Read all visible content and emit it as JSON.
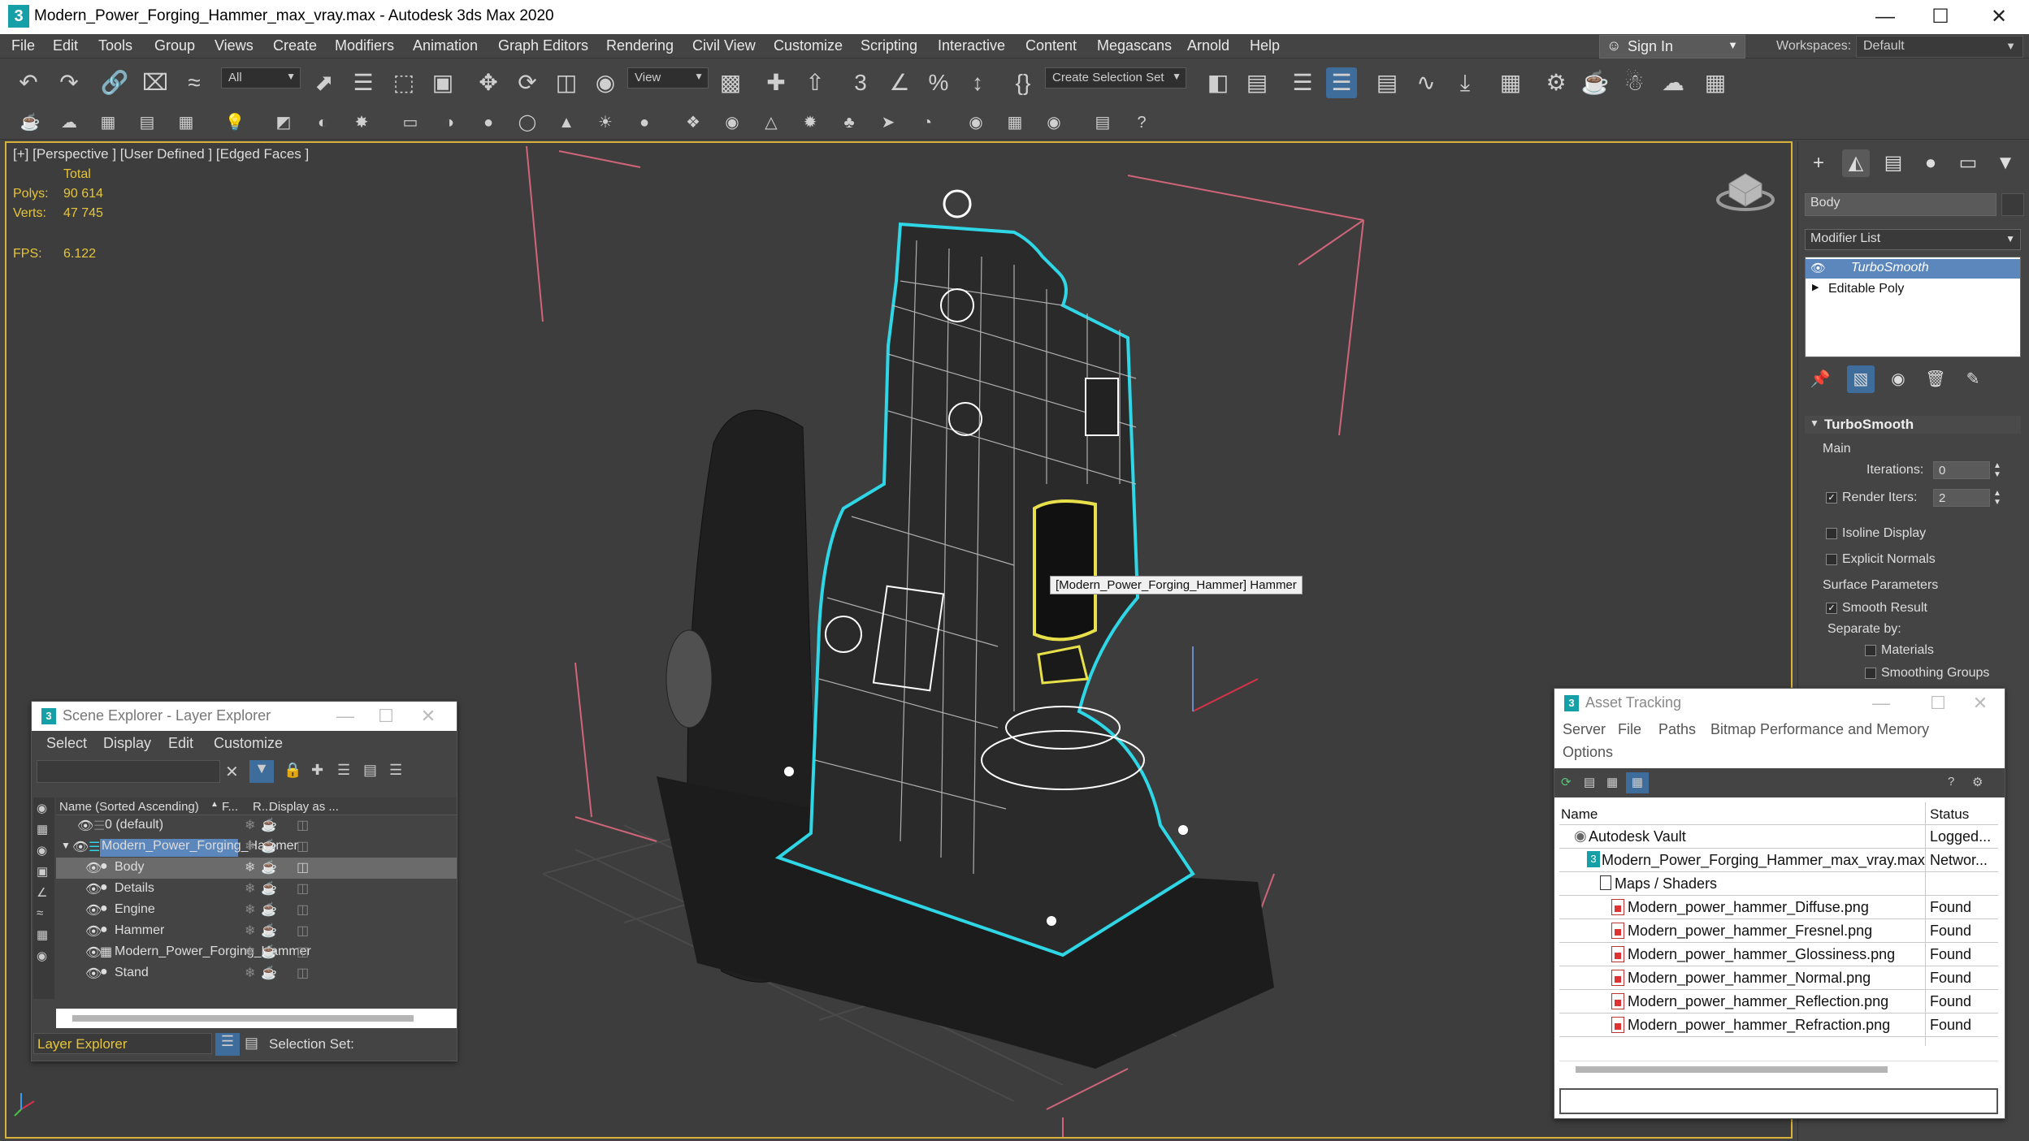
{
  "window": {
    "title": "Modern_Power_Forging_Hammer_max_vray.max - Autodesk 3ds Max 2020",
    "icon": "3"
  },
  "menu": [
    "File",
    "Edit",
    "Tools",
    "Group",
    "Views",
    "Create",
    "Modifiers",
    "Animation",
    "Graph Editors",
    "Rendering",
    "Civil View",
    "Customize",
    "Scripting",
    "Interactive",
    "Content",
    "Megascans",
    "Arnold",
    "Help"
  ],
  "signin": "Sign In",
  "workspaces": {
    "label": "Workspaces:",
    "value": "Default"
  },
  "toolbar": {
    "filter": "All",
    "refcoord": "View",
    "selection_set": "Create Selection Set"
  },
  "viewport": {
    "label": "[+] [Perspective ] [User Defined ] [Edged Faces ]",
    "stats": {
      "total": "Total",
      "polys_label": "Polys:",
      "polys": "90 614",
      "verts_label": "Verts:",
      "verts": "47 745",
      "fps_label": "FPS:",
      "fps": "6.122"
    },
    "tooltip": "[Modern_Power_Forging_Hammer] Hammer"
  },
  "command_panel": {
    "object_name": "Body",
    "modifier_list": "Modifier List",
    "stack": [
      "TurboSmooth",
      "Editable Poly"
    ],
    "rollout": "TurboSmooth",
    "main": "Main",
    "iterations_label": "Iterations:",
    "iterations": "0",
    "render_iters_label": "Render Iters:",
    "render_iters": "2",
    "isoline": "Isoline Display",
    "explicit": "Explicit Normals",
    "surface": "Surface Parameters",
    "smooth_result": "Smooth Result",
    "separate_by": "Separate by:",
    "materials": "Materials",
    "smoothing_groups": "Smoothing Groups"
  },
  "scene_explorer": {
    "title": "Scene Explorer - Layer Explorer",
    "menu": [
      "Select",
      "Display",
      "Edit",
      "Customize"
    ],
    "columns": {
      "name": "Name (Sorted Ascending)",
      "f": "F...",
      "r": "R...",
      "display": "Display as ..."
    },
    "rows": [
      {
        "label": "0 (default)",
        "level": 0
      },
      {
        "label": "Modern_Power_Forging_Hammer",
        "level": 0
      },
      {
        "label": "Body",
        "level": 1
      },
      {
        "label": "Details",
        "level": 1
      },
      {
        "label": "Engine",
        "level": 1
      },
      {
        "label": "Hammer",
        "level": 1
      },
      {
        "label": "Modern_Power_Forging_Hammer",
        "level": 1
      },
      {
        "label": "Stand",
        "level": 1
      }
    ],
    "footer_layer": "Layer Explorer",
    "footer_selection": "Selection Set:"
  },
  "asset_tracking": {
    "title": "Asset Tracking",
    "menu": [
      "Server",
      "File",
      "Paths",
      "Bitmap Performance and Memory",
      "Options"
    ],
    "columns": {
      "name": "Name",
      "status": "Status"
    },
    "rows": [
      {
        "name": "Autodesk Vault",
        "status": "Logged...",
        "indent": 0
      },
      {
        "name": "Modern_Power_Forging_Hammer_max_vray.max",
        "status": "Networ...",
        "indent": 1
      },
      {
        "name": "Maps / Shaders",
        "status": "",
        "indent": 2
      },
      {
        "name": "Modern_power_hammer_Diffuse.png",
        "status": "Found",
        "indent": 3
      },
      {
        "name": "Modern_power_hammer_Fresnel.png",
        "status": "Found",
        "indent": 3
      },
      {
        "name": "Modern_power_hammer_Glossiness.png",
        "status": "Found",
        "indent": 3
      },
      {
        "name": "Modern_power_hammer_Normal.png",
        "status": "Found",
        "indent": 3
      },
      {
        "name": "Modern_power_hammer_Reflection.png",
        "status": "Found",
        "indent": 3
      },
      {
        "name": "Modern_power_hammer_Refraction.png",
        "status": "Found",
        "indent": 3
      }
    ]
  },
  "colors": {
    "selection_outline": "#2fd6e6",
    "viewport_border": "#d9b23c",
    "stats": "#e6c53a",
    "accent": "#3e6d9c"
  }
}
